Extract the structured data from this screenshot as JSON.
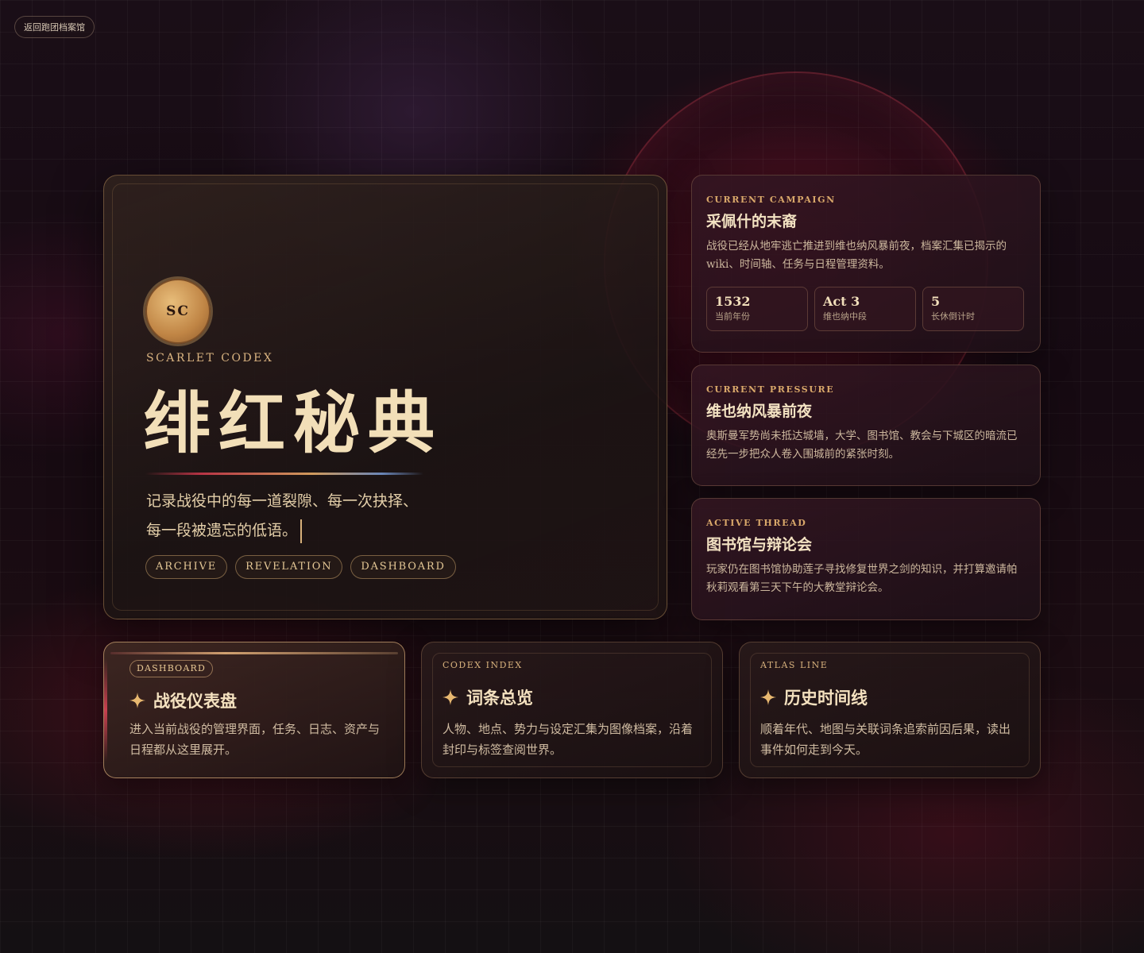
{
  "back_link": "返回跑团档案馆",
  "hero": {
    "crest": "SC",
    "eyebrow": "SCARLET CODEX",
    "title": "绯红秘典",
    "desc_line1": "记录战役中的每一道裂隙、每一次抉择、",
    "desc_line2": "每一段被遗忘的低语。",
    "tags": [
      "ARCHIVE",
      "REVELATION",
      "DASHBOARD"
    ]
  },
  "campaign": {
    "eyebrow": "CURRENT CAMPAIGN",
    "title": "采佩什的末裔",
    "text": "战役已经从地牢逃亡推进到维也纳风暴前夜，档案汇集已揭示的 wiki、时间轴、任务与日程管理资料。",
    "stats": [
      {
        "value": "1532",
        "label": "当前年份"
      },
      {
        "value": "Act 3",
        "label": "维也纳中段"
      },
      {
        "value": "5",
        "label": "长休倒计时"
      }
    ]
  },
  "pressure": {
    "eyebrow": "CURRENT PRESSURE",
    "title": "维也纳风暴前夜",
    "text": "奥斯曼军势尚未抵达城墙，大学、图书馆、教会与下城区的暗流已经先一步把众人卷入围城前的紧张时刻。"
  },
  "thread": {
    "eyebrow": "ACTIVE THREAD",
    "title": "图书馆与辩论会",
    "text": "玩家仍在图书馆协助莲子寻找修复世界之剑的知识，并打算邀请帕秋莉观看第三天下午的大教堂辩论会。"
  },
  "nav_cards": {
    "dashboard": {
      "pill": "DASHBOARD",
      "title": "战役仪表盘",
      "text": "进入当前战役的管理界面，任务、日志、资产与日程都从这里展开。"
    },
    "codex": {
      "eyebrow": "CODEX INDEX",
      "title": "词条总览",
      "text": "人物、地点、势力与设定汇集为图像档案，沿着封印与标签查阅世界。"
    },
    "atlas": {
      "eyebrow": "ATLAS LINE",
      "title": "历史时间线",
      "text": "顺着年代、地图与关联词条追索前因后果，读出事件如何走到今天。"
    }
  },
  "icons": {
    "nav_card_icon": "sparkle-icon"
  },
  "colors": {
    "accent_gold": "#d9a86a",
    "accent_crimson": "#b83445",
    "title_cream": "#f2dfb8"
  }
}
